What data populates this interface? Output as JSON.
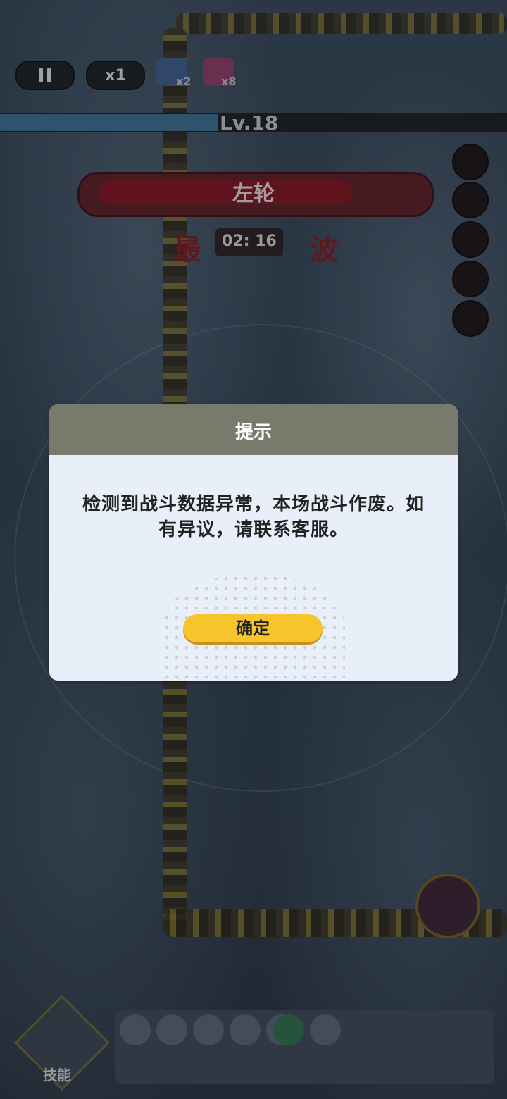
{
  "hud": {
    "pause_icon": "pause-icon",
    "speed_label": "x1",
    "items": [
      {
        "icon": "blue-chest-icon",
        "count": "x2"
      },
      {
        "icon": "pink-chest-icon",
        "count": "x8"
      }
    ],
    "level_label": "Lv.18",
    "xp_progress": 0.43
  },
  "boss": {
    "name": "左轮",
    "health_fraction": 0.72
  },
  "wave": {
    "text_left": "最",
    "text_right": "波",
    "timer": "02: 16"
  },
  "portraits": [
    "portrait-1",
    "portrait-2",
    "portrait-3",
    "portrait-4",
    "portrait-5"
  ],
  "bottom": {
    "skill_label": "技能",
    "equipment_icons": [
      "dragon-icon",
      "amulet-icon",
      "armor-icon",
      "helmet-icon",
      "satellite-icon",
      "ring-icon",
      "belt-icon"
    ]
  },
  "dialog": {
    "title": "提示",
    "message": "检测到战斗数据异常，本场战斗作废。如有异议，请联系客服。",
    "confirm_label": "确定"
  },
  "colors": {
    "dialog_header": "#787a6c",
    "dialog_body": "#e9eff8",
    "confirm_button": "#f8c42c"
  }
}
